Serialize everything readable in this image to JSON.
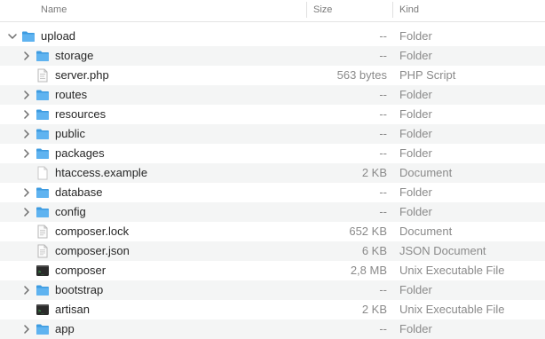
{
  "columns": {
    "name": "Name",
    "size": "Size",
    "kind": "Kind"
  },
  "colors": {
    "folder": "#5fb3f0",
    "folder_dark": "#3d9be0",
    "text": "#262626",
    "muted": "#8a8a8a",
    "stripe": "#f4f5f5"
  },
  "rows": [
    {
      "name": "upload",
      "size": "--",
      "kind": "Folder",
      "icon": "folder-icon",
      "level": 0,
      "disclosure": "expanded"
    },
    {
      "name": "storage",
      "size": "--",
      "kind": "Folder",
      "icon": "folder-icon",
      "level": 1,
      "disclosure": "collapsed"
    },
    {
      "name": "server.php",
      "size": "563 bytes",
      "kind": "PHP Script",
      "icon": "script-file-icon",
      "level": 1,
      "disclosure": "none"
    },
    {
      "name": "routes",
      "size": "--",
      "kind": "Folder",
      "icon": "folder-icon",
      "level": 1,
      "disclosure": "collapsed"
    },
    {
      "name": "resources",
      "size": "--",
      "kind": "Folder",
      "icon": "folder-icon",
      "level": 1,
      "disclosure": "collapsed"
    },
    {
      "name": "public",
      "size": "--",
      "kind": "Folder",
      "icon": "folder-icon",
      "level": 1,
      "disclosure": "collapsed"
    },
    {
      "name": "packages",
      "size": "--",
      "kind": "Folder",
      "icon": "folder-icon",
      "level": 1,
      "disclosure": "collapsed"
    },
    {
      "name": "htaccess.example",
      "size": "2 KB",
      "kind": "Document",
      "icon": "document-icon",
      "level": 1,
      "disclosure": "none"
    },
    {
      "name": "database",
      "size": "--",
      "kind": "Folder",
      "icon": "folder-icon",
      "level": 1,
      "disclosure": "collapsed"
    },
    {
      "name": "config",
      "size": "--",
      "kind": "Folder",
      "icon": "folder-icon",
      "level": 1,
      "disclosure": "collapsed"
    },
    {
      "name": "composer.lock",
      "size": "652 KB",
      "kind": "Document",
      "icon": "text-file-icon",
      "level": 1,
      "disclosure": "none"
    },
    {
      "name": "composer.json",
      "size": "6 KB",
      "kind": "JSON Document",
      "icon": "text-file-icon",
      "level": 1,
      "disclosure": "none"
    },
    {
      "name": "composer",
      "size": "2,8 MB",
      "kind": "Unix Executable File",
      "icon": "terminal-icon",
      "level": 1,
      "disclosure": "none"
    },
    {
      "name": "bootstrap",
      "size": "--",
      "kind": "Folder",
      "icon": "folder-icon",
      "level": 1,
      "disclosure": "collapsed"
    },
    {
      "name": "artisan",
      "size": "2 KB",
      "kind": "Unix Executable File",
      "icon": "terminal-icon",
      "level": 1,
      "disclosure": "none"
    },
    {
      "name": "app",
      "size": "--",
      "kind": "Folder",
      "icon": "folder-icon",
      "level": 1,
      "disclosure": "collapsed"
    }
  ]
}
